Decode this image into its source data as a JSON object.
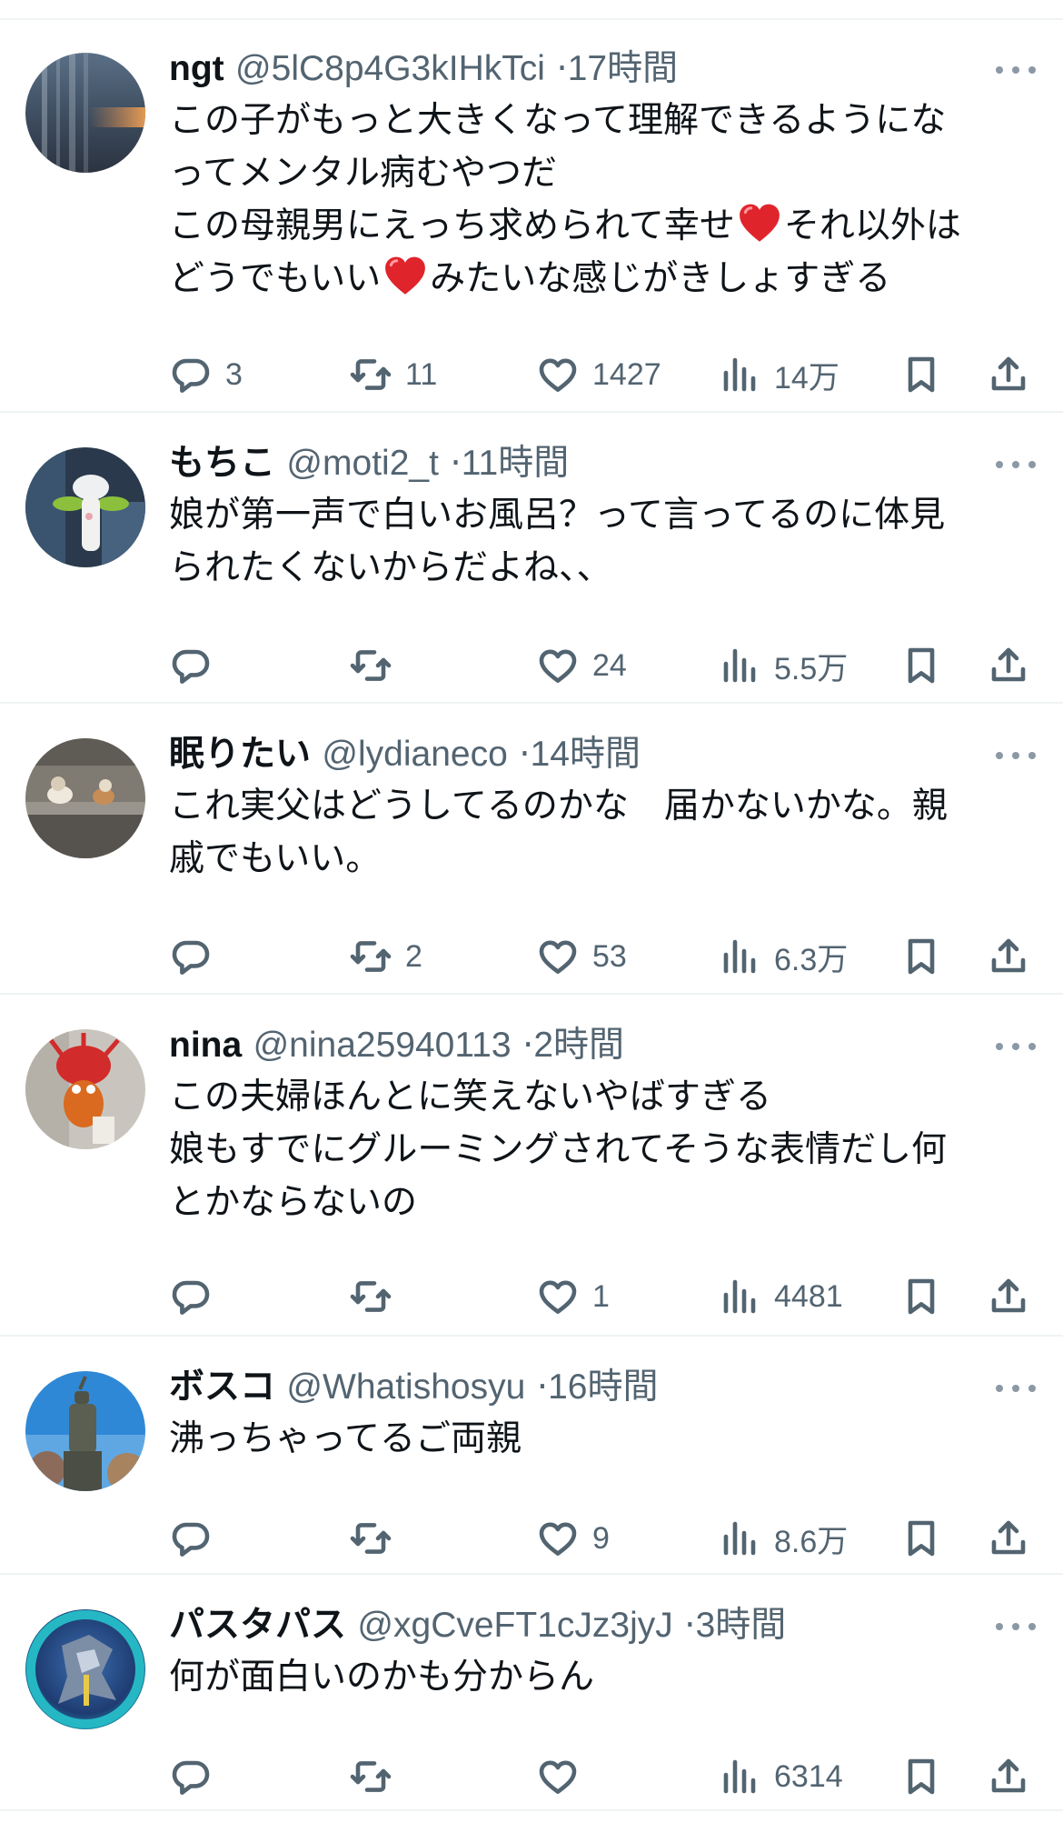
{
  "replies": [
    {
      "name": "ngt",
      "handle": "@5lC8p4G3kIHkTci",
      "time": "17時間",
      "lines": [
        [
          "この子がもっと大きくなって理解できるようにな"
        ],
        [
          "ってメンタル病むやつだ"
        ],
        [
          "この母親男にえっち求められて幸せ",
          "それ以外は"
        ],
        [
          "どうでもいい",
          "みたいな感じがきしょすぎる"
        ]
      ],
      "counts": {
        "reply": "3",
        "retweet": "11",
        "like": "1427",
        "views": "14万"
      }
    },
    {
      "name": "もちこ",
      "handle": "@moti2_t",
      "time": "11時間",
      "lines": [
        [
          "娘が第一声で白いお風呂？って言ってるのに体見"
        ],
        [
          "られたくないからだよね、、"
        ]
      ],
      "counts": {
        "reply": "",
        "retweet": "",
        "like": "24",
        "views": "5.5万"
      }
    },
    {
      "name": "眠りたい",
      "handle": "@lydianeco",
      "time": "14時間",
      "lines": [
        [
          "これ実父はどうしてるのかな　届かないかな。親"
        ],
        [
          "戚でもいい。"
        ]
      ],
      "counts": {
        "reply": "",
        "retweet": "2",
        "like": "53",
        "views": "6.3万"
      }
    },
    {
      "name": "nina",
      "handle": "@nina25940113",
      "time": "2時間",
      "lines": [
        [
          "この夫婦ほんとに笑えないやばすぎる"
        ],
        [
          "娘もすでにグルーミングされてそうな表情だし何"
        ],
        [
          "とかならないの"
        ]
      ],
      "counts": {
        "reply": "",
        "retweet": "",
        "like": "1",
        "views": "4481"
      }
    },
    {
      "name": "ボスコ",
      "handle": "@Whatishosyu",
      "time": "16時間",
      "lines": [
        [
          "沸っちゃってるご両親"
        ]
      ],
      "counts": {
        "reply": "",
        "retweet": "",
        "like": "9",
        "views": "8.6万"
      }
    },
    {
      "name": "パスタパス",
      "handle": "@xgCveFT1cJz3jyJ",
      "time": "3時間",
      "lines": [
        [
          "何が面白いのかも分からん"
        ]
      ],
      "counts": {
        "reply": "",
        "retweet": "",
        "like": "",
        "views": "6314"
      }
    }
  ],
  "icons": {
    "reply": "reply-bubble-icon",
    "retweet": "retweet-icon",
    "like": "heart-outline-icon",
    "views": "views-bars-icon",
    "bookmark": "bookmark-icon",
    "share": "share-upload-icon",
    "more": "more-dots-icon",
    "emoji": "red-heart-emoji"
  },
  "colors": {
    "text": "#0f1419",
    "secondary": "#536471",
    "divider": "#eff3f4",
    "emoji_heart": "#e0242b"
  }
}
